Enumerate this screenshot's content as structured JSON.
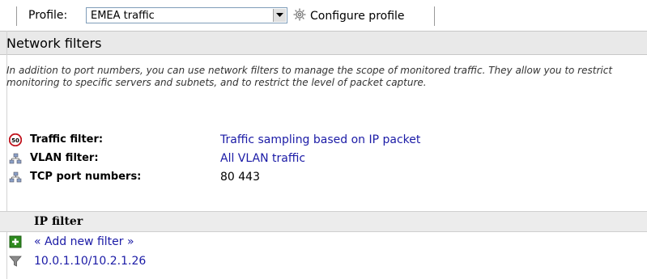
{
  "toolbar": {
    "profile_label": "Profile:",
    "profile_value": "EMEA traffic",
    "configure_label": "Configure profile"
  },
  "section": {
    "title": "Network filters",
    "description": "In addition to port numbers, you can use network filters to manage the scope of monitored traffic. They allow you to restrict monitoring to specific servers and subnets, and to restrict the level of packet capture."
  },
  "filters": [
    {
      "label": "Traffic filter:",
      "value": "Traffic sampling based on IP packet",
      "icon": "speed-limit-50-icon"
    },
    {
      "label": "VLAN filter:",
      "value": "All VLAN traffic",
      "icon": "network-icon"
    },
    {
      "label": "TCP port numbers:",
      "value": "80 443",
      "icon": "network-icon"
    }
  ],
  "ip_filter": {
    "header": "IP filter",
    "add_label": "« Add new filter »",
    "entries": [
      "10.0.1.10/10.2.1.26"
    ]
  },
  "colors": {
    "link": "#1a1aa6",
    "header_bg": "#e9e9e9",
    "add_icon": "#2e8b1f"
  }
}
